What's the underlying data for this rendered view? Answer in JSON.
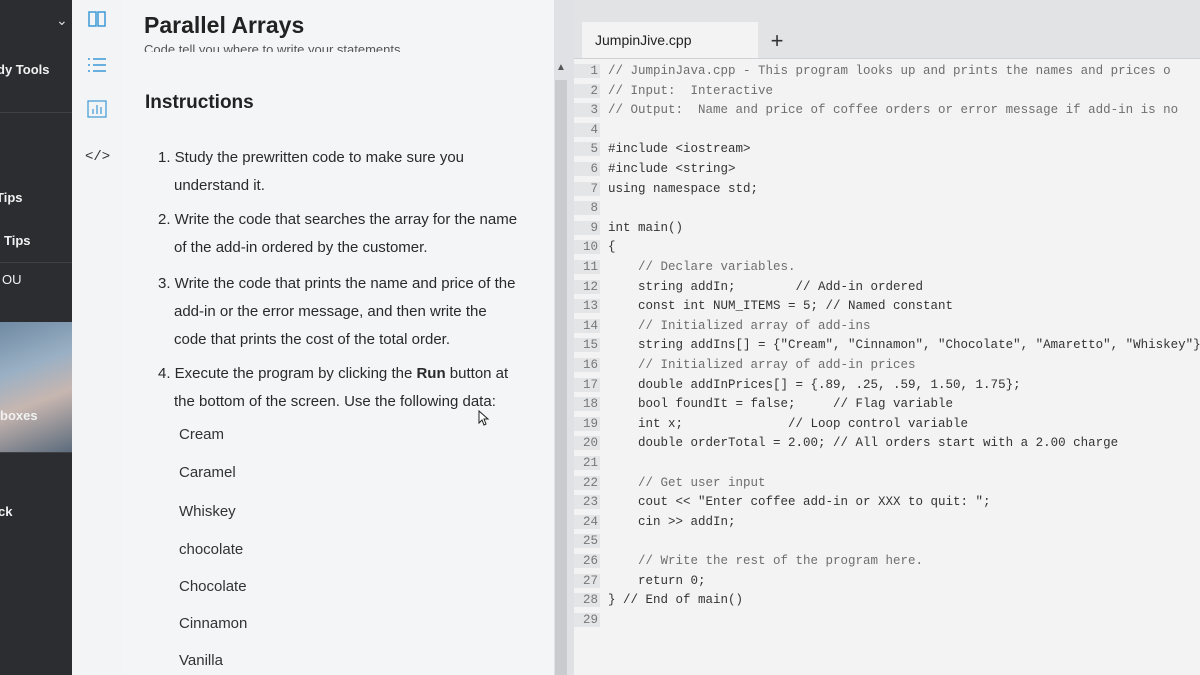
{
  "nav": {
    "items": [
      "dy Tools",
      "Tips",
      "Tips",
      "ou",
      "boxes",
      "ck"
    ]
  },
  "panel": {
    "title": "Parallel Arrays",
    "cut_line": "Code tell you where to write your statements.",
    "heading": "Instructions",
    "steps": [
      {
        "lines": [
          "1. Study the prewritten code to make sure you",
          "understand it."
        ]
      },
      {
        "lines": [
          "2. Write the code that searches the array for the name",
          "of the add-in ordered by the customer."
        ]
      },
      {
        "lines": [
          "3. Write the code that prints the name and price of the",
          "add-in or the error message, and then write the",
          "code that prints the cost of the total order."
        ]
      },
      {
        "lines": [
          "4. Execute the program by clicking the ",
          "Run",
          " button at",
          "the bottom of the screen. Use the following data:"
        ]
      }
    ],
    "data_values": [
      "Cream",
      "Caramel",
      "Whiskey",
      "chocolate",
      "Chocolate",
      "Cinnamon",
      "Vanilla"
    ]
  },
  "editor": {
    "tab_label": "JumpinJive.cpp",
    "add_tab": "+",
    "lines": [
      {
        "n": "1",
        "t": "// JumpinJava.cpp - This program looks up and prints the names and prices o"
      },
      {
        "n": "2",
        "t": "// Input:  Interactive"
      },
      {
        "n": "3",
        "t": "// Output:  Name and price of coffee orders or error message if add-in is no"
      },
      {
        "n": "4",
        "t": ""
      },
      {
        "n": "5",
        "t": "#include <iostream>"
      },
      {
        "n": "6",
        "t": "#include <string>"
      },
      {
        "n": "7",
        "t": "using namespace std;"
      },
      {
        "n": "8",
        "t": ""
      },
      {
        "n": "9",
        "t": "int main()"
      },
      {
        "n": "10",
        "t": "{"
      },
      {
        "n": "11",
        "t": "    // Declare variables."
      },
      {
        "n": "12",
        "t": "    string addIn;        // Add-in ordered"
      },
      {
        "n": "13",
        "t": "    const int NUM_ITEMS = 5; // Named constant"
      },
      {
        "n": "14",
        "t": "    // Initialized array of add-ins"
      },
      {
        "n": "15",
        "t": "    string addIns[] = {\"Cream\", \"Cinnamon\", \"Chocolate\", \"Amaretto\", \"Whiskey\"};"
      },
      {
        "n": "16",
        "t": "    // Initialized array of add-in prices"
      },
      {
        "n": "17",
        "t": "    double addInPrices[] = {.89, .25, .59, 1.50, 1.75};"
      },
      {
        "n": "18",
        "t": "    bool foundIt = false;     // Flag variable"
      },
      {
        "n": "19",
        "t": "    int x;              // Loop control variable"
      },
      {
        "n": "20",
        "t": "    double orderTotal = 2.00; // All orders start with a 2.00 charge"
      },
      {
        "n": "21",
        "t": ""
      },
      {
        "n": "22",
        "t": "    // Get user input"
      },
      {
        "n": "23",
        "t": "    cout << \"Enter coffee add-in or XXX to quit: \";"
      },
      {
        "n": "24",
        "t": "    cin >> addIn;"
      },
      {
        "n": "25",
        "t": ""
      },
      {
        "n": "26",
        "t": "    // Write the rest of the program here."
      },
      {
        "n": "27",
        "t": "    return 0;"
      },
      {
        "n": "28",
        "t": "} // End of main()"
      },
      {
        "n": "29",
        "t": ""
      }
    ]
  }
}
